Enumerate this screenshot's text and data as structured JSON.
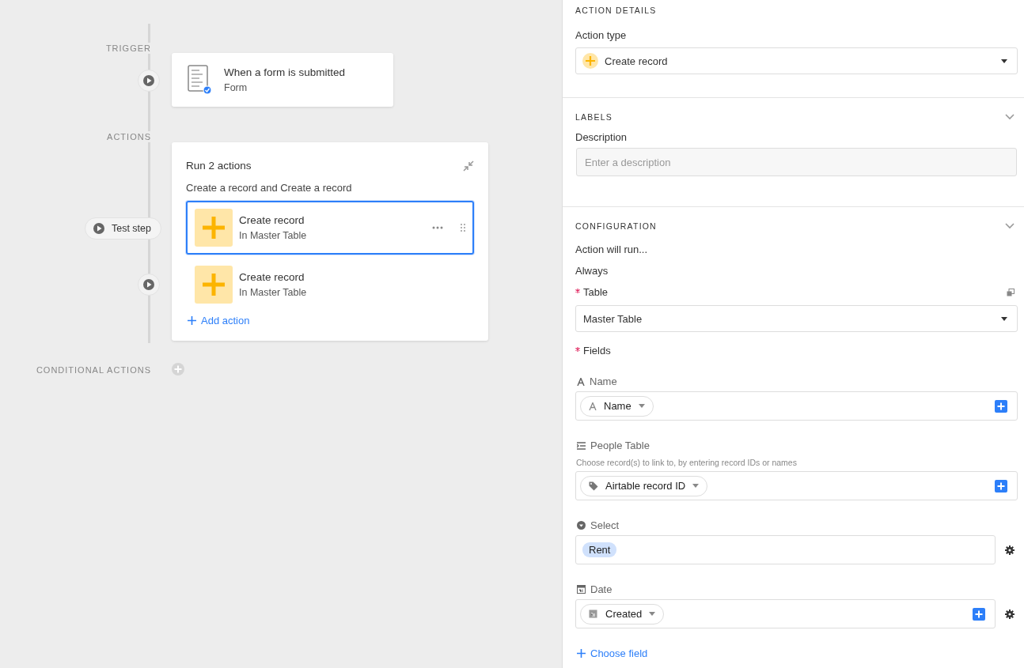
{
  "canvas": {
    "trigger": {
      "label": "TRIGGER",
      "title": "When a form is submitted",
      "subtitle": "Form"
    },
    "actions": {
      "label": "ACTIONS",
      "title": "Run 2 actions",
      "description": "Create a record and Create a record",
      "test_step": "Test step",
      "add_action": "Add action",
      "items": [
        {
          "title": "Create record",
          "subtitle": "In Master Table",
          "selected": true
        },
        {
          "title": "Create record",
          "subtitle": "In Master Table",
          "selected": false
        }
      ]
    },
    "conditional": {
      "label": "CONDITIONAL ACTIONS"
    }
  },
  "panel": {
    "action_details": {
      "heading": "ACTION DETAILS",
      "label": "Action type",
      "value": "Create record"
    },
    "labels": {
      "heading": "LABELS",
      "collapsible": true,
      "label": "Description",
      "placeholder": "Enter a description"
    },
    "configuration": {
      "heading": "CONFIGURATION",
      "collapsible": true,
      "run_label": "Action will run...",
      "run_value": "Always",
      "table_label": "Table",
      "table_required": true,
      "fields_required": true,
      "table_value": "Master Table",
      "fields_label": "Fields",
      "choose_field": "Choose field",
      "fields": [
        {
          "kind": "text",
          "label": "Name",
          "value": "Name",
          "add_button": true,
          "settings": false
        },
        {
          "kind": "link",
          "label": "People Table",
          "hint": "Choose record(s) to link to, by entering record IDs or names",
          "value": "Airtable record ID",
          "add_button": true,
          "settings": false
        },
        {
          "kind": "select",
          "label": "Select",
          "value": "Rent",
          "add_button": false,
          "settings": true
        },
        {
          "kind": "date",
          "label": "Date",
          "value": "Created",
          "add_button": true,
          "settings": true
        }
      ]
    }
  }
}
